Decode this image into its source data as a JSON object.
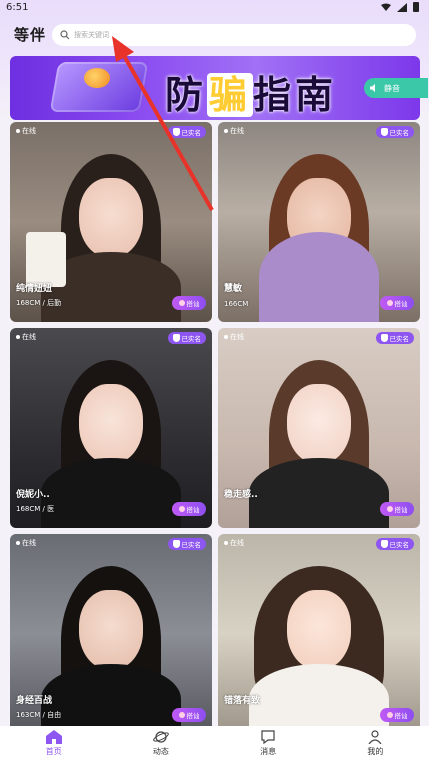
{
  "status_bar": {
    "time": "6:51"
  },
  "header": {
    "app_title": "等伴",
    "search_placeholder": "搜索关键词"
  },
  "banner": {
    "text_before": "防",
    "text_highlight": "骗",
    "text_after": "指南",
    "mute_label": "静音"
  },
  "cards": [
    {
      "status": "在线",
      "verified": "已实名",
      "name": "纯情妞妞",
      "info": "168CM / 后勤",
      "chat_label": "搭讪"
    },
    {
      "status": "在线",
      "verified": "已实名",
      "name": "慧敏",
      "info": "166CM",
      "chat_label": "搭讪"
    },
    {
      "status": "在线",
      "verified": "已实名",
      "name": "倪妮小..",
      "info": "168CM / 医",
      "chat_label": "搭讪"
    },
    {
      "status": "在线",
      "verified": "已实名",
      "name": "稳走感..",
      "info": "",
      "chat_label": "搭讪"
    },
    {
      "status": "在线",
      "verified": "已实名",
      "name": "身经百战",
      "info": "163CM / 自由",
      "chat_label": "搭讪"
    },
    {
      "status": "在线",
      "verified": "已实名",
      "name": "错落有致",
      "info": "",
      "chat_label": "搭讪"
    }
  ],
  "tabbar": [
    {
      "label": "首页",
      "icon": "home-icon",
      "active": true
    },
    {
      "label": "动态",
      "icon": "planet-icon",
      "active": false
    },
    {
      "label": "消息",
      "icon": "message-icon",
      "active": false
    },
    {
      "label": "我的",
      "icon": "profile-icon",
      "active": false
    }
  ],
  "colors": {
    "accent": "#8e56f0",
    "mute_button": "#3ac8a8",
    "annotation_arrow": "#e8332b"
  }
}
